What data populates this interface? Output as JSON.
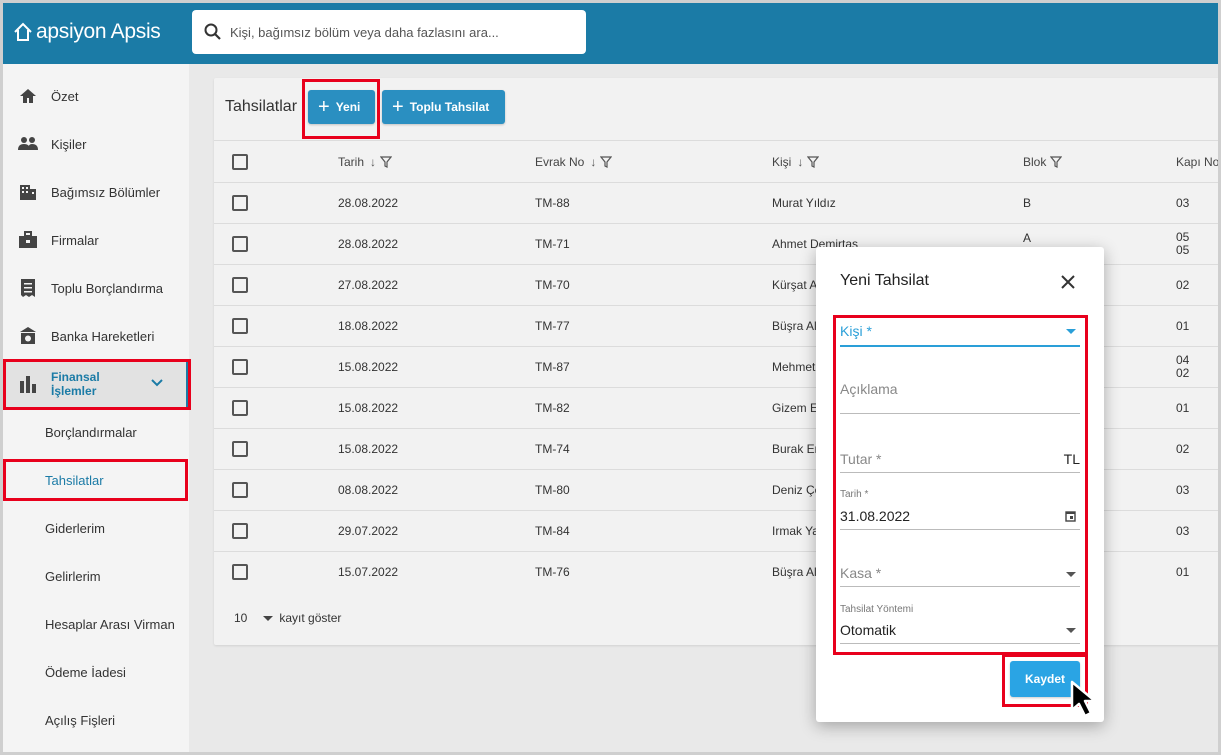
{
  "app": {
    "logo": "apsiyon Apsis"
  },
  "search": {
    "placeholder": "Kişi, bağımsız bölüm veya daha fazlasını ara..."
  },
  "sidebar": {
    "items": [
      {
        "label": "Özet",
        "icon": "home-icon"
      },
      {
        "label": "Kişiler",
        "icon": "people-icon"
      },
      {
        "label": "Bağımsız Bölümler",
        "icon": "building-icon"
      },
      {
        "label": "Firmalar",
        "icon": "briefcase-icon"
      },
      {
        "label": "Toplu Borçlandırma",
        "icon": "receipt-icon"
      },
      {
        "label": "Banka Hareketleri",
        "icon": "bank-icon"
      }
    ],
    "active": {
      "label_line1": "Finansal",
      "label_line2": "İşlemler",
      "icon": "bar-chart-icon"
    },
    "subitems": [
      "Borçlandırmalar",
      "Tahsilatlar",
      "Giderlerim",
      "Gelirlerim",
      "Hesaplar Arası Virman",
      "Ödeme İadesi",
      "Açılış Fişleri"
    ]
  },
  "main": {
    "title": "Tahsilatlar",
    "new_button": "Yeni",
    "bulk_button": "Toplu Tahsilat",
    "columns": [
      "Tarih",
      "Evrak No",
      "Kişi",
      "Blok",
      "Kapı No"
    ],
    "rows": [
      {
        "tarih": "28.08.2022",
        "evrak": "TM-88",
        "kisi": "Murat Yıldız",
        "blok": "B",
        "kapi": "03",
        "kapi2": ""
      },
      {
        "tarih": "28.08.2022",
        "evrak": "TM-71",
        "kisi": "Ahmet Demirtaş",
        "blok": "A",
        "kapi": "05",
        "kapi2": "05"
      },
      {
        "tarih": "27.08.2022",
        "evrak": "TM-70",
        "kisi": "Kürşat A",
        "blok": "",
        "kapi": "02",
        "kapi2": ""
      },
      {
        "tarih": "18.08.2022",
        "evrak": "TM-77",
        "kisi": "Büşra Al",
        "blok": "",
        "kapi": "01",
        "kapi2": ""
      },
      {
        "tarih": "15.08.2022",
        "evrak": "TM-87",
        "kisi": "Mehmet",
        "blok": "",
        "kapi": "04",
        "kapi2": "02"
      },
      {
        "tarih": "15.08.2022",
        "evrak": "TM-82",
        "kisi": "Gizem E",
        "blok": "",
        "kapi": "01",
        "kapi2": ""
      },
      {
        "tarih": "15.08.2022",
        "evrak": "TM-74",
        "kisi": "Burak Er",
        "blok": "",
        "kapi": "02",
        "kapi2": ""
      },
      {
        "tarih": "08.08.2022",
        "evrak": "TM-80",
        "kisi": "Deniz Çe",
        "blok": "",
        "kapi": "03",
        "kapi2": ""
      },
      {
        "tarih": "29.07.2022",
        "evrak": "TM-84",
        "kisi": "Irmak Ya",
        "blok": "",
        "kapi": "03",
        "kapi2": ""
      },
      {
        "tarih": "15.07.2022",
        "evrak": "TM-76",
        "kisi": "Büşra Al",
        "blok": "",
        "kapi": "01",
        "kapi2": ""
      }
    ],
    "page_size": "10",
    "page_size_label": "kayıt göster"
  },
  "modal": {
    "title": "Yeni Tahsilat",
    "kisi_label": "Kişi *",
    "aciklama_label": "Açıklama",
    "tutar_label": "Tutar *",
    "tutar_suffix": "TL",
    "tarih_label": "Tarih *",
    "tarih_value": "31.08.2022",
    "kasa_label": "Kasa *",
    "yontem_label": "Tahsilat Yöntemi",
    "yontem_value": "Otomatik",
    "save_button": "Kaydet"
  },
  "colors": {
    "brand": "#1b7ba6",
    "button": "#2a8fc1",
    "highlight": "#e8001c",
    "focus": "#2a9fd8"
  }
}
